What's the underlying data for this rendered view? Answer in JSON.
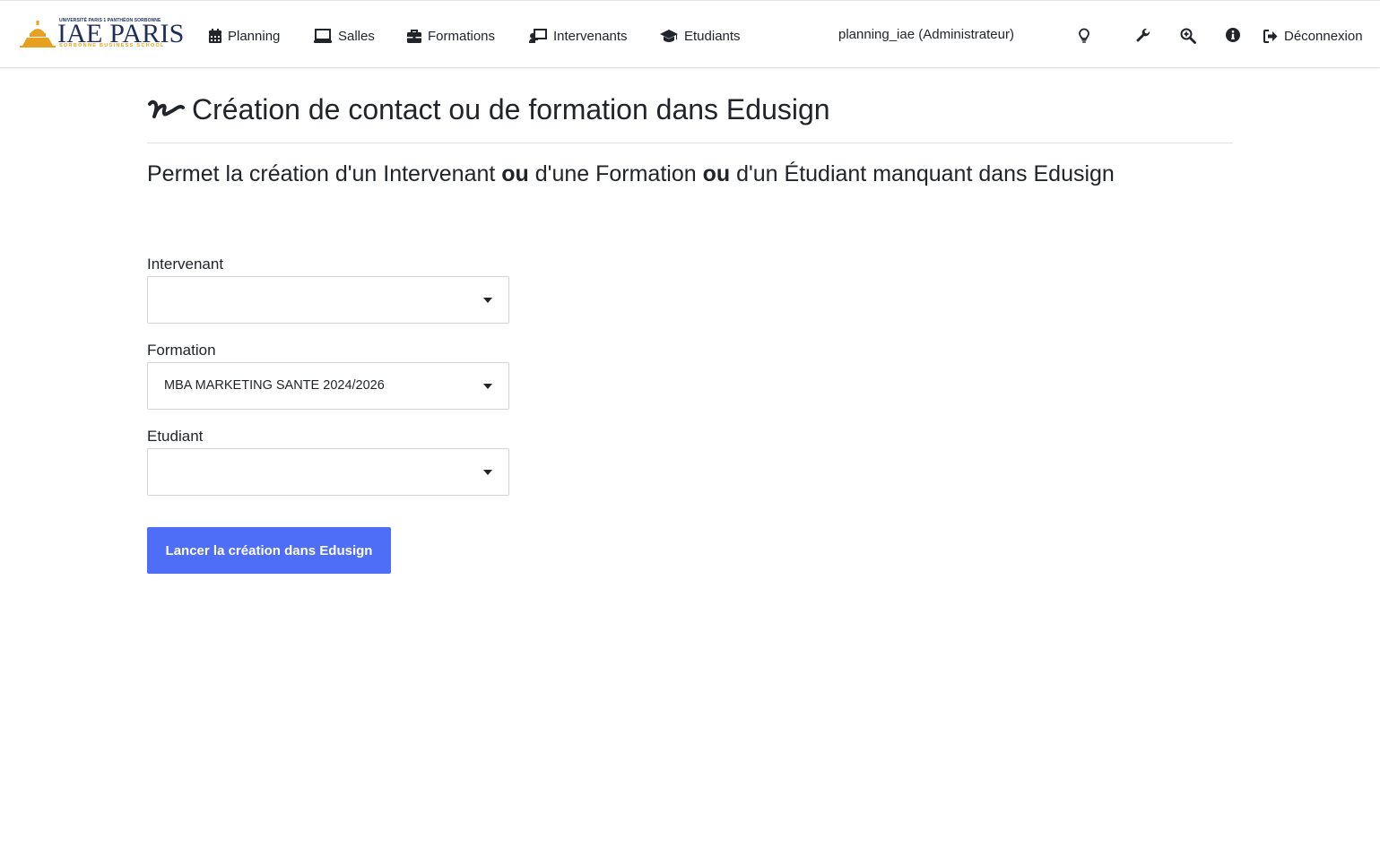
{
  "header": {
    "logo": {
      "top_line": "UNIVERSITÉ PARIS 1 PANTHÉON SORBONNE",
      "name": "IAE PARIS",
      "tagline": "SORBONNE BUSINESS SCHOOL"
    },
    "nav": [
      {
        "label": "Planning",
        "icon": "calendar-icon"
      },
      {
        "label": "Salles",
        "icon": "laptop-icon"
      },
      {
        "label": "Formations",
        "icon": "briefcase-icon"
      },
      {
        "label": "Intervenants",
        "icon": "chalkboard-teacher-icon"
      },
      {
        "label": "Etudiants",
        "icon": "graduation-cap-icon"
      }
    ],
    "user": "planning_iae (Administrateur)",
    "tools": [
      "lightbulb-icon",
      "wrench-icon",
      "zoom-in-icon",
      "info-icon"
    ],
    "logout_label": "Déconnexion"
  },
  "page": {
    "title": "Création de contact ou de formation dans Edusign",
    "subtitle": {
      "part1": "Permet la création d'un Intervenant ",
      "bold1": "ou",
      "part2": " d'une Formation ",
      "bold2": "ou",
      "part3": " d'un Étudiant manquant dans Edusign"
    }
  },
  "form": {
    "intervenant": {
      "label": "Intervenant",
      "value": ""
    },
    "formation": {
      "label": "Formation",
      "value": "MBA MARKETING SANTE 2024/2026"
    },
    "etudiant": {
      "label": "Etudiant",
      "value": ""
    },
    "submit_label": "Lancer la création dans Edusign"
  },
  "colors": {
    "primary_button": "#4f6ef7",
    "logo_navy": "#1f2d5a",
    "logo_orange": "#e8a020"
  }
}
